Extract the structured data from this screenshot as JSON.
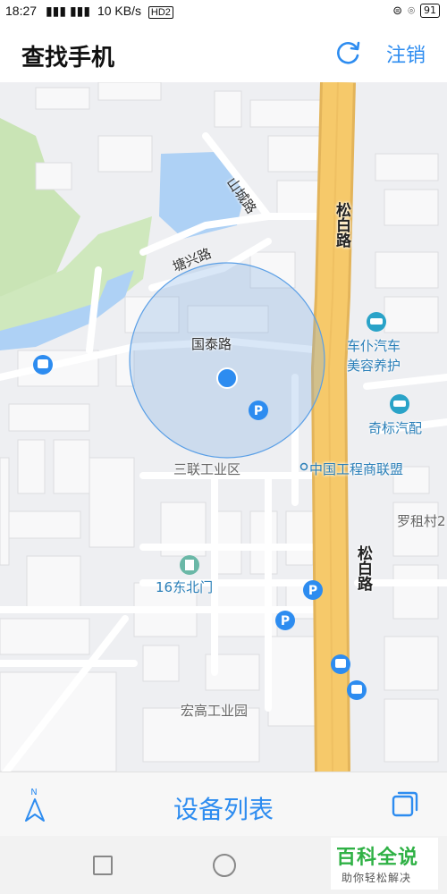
{
  "status_bar": {
    "time": "18:27",
    "network_info": "10 KB/s",
    "hd_badge": "HD2",
    "battery": "91"
  },
  "header": {
    "title": "查找手机",
    "refresh_icon": "refresh-icon",
    "logout_label": "注销"
  },
  "map": {
    "labels": {
      "songbai_road_top": "松白路",
      "songbai_road_bottom": "松白路",
      "tangxing_road": "塘兴路",
      "guotai_road": "国泰路",
      "shancheng_road": "山城路",
      "chepu_car": "车仆汽车",
      "chepu_car2": "美容养护",
      "qibiao_car": "奇标汽配",
      "sanlian": "三联工业区",
      "zhongguo": "中国工程商联盟",
      "luozu": "罗租村2",
      "dongbei": "16东北门",
      "honggao": "宏高工业园"
    },
    "accent_blue": "#2d8cf0",
    "road_yellow": "#f6c96a"
  },
  "bottom_bar": {
    "compass_label": "N",
    "device_list_label": "设备列表"
  },
  "watermark": {
    "title": "百科全说",
    "subtitle": "助你轻松解决"
  }
}
